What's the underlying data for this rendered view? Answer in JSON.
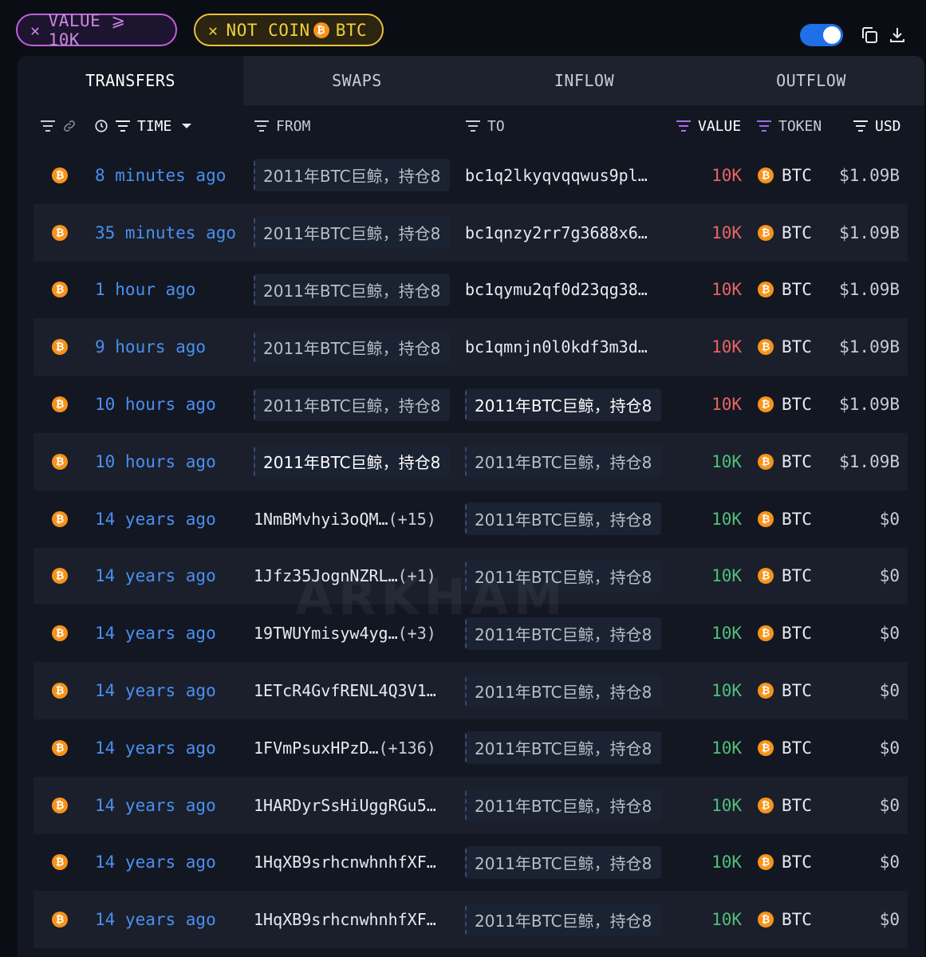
{
  "filters": [
    {
      "label": "VALUE ⩾ 10K",
      "color": "#c25fdc"
    },
    {
      "label_prefix": "NOT COIN",
      "coin_symbol": "₿",
      "label_suffix": "BTC",
      "color": "#e9c23a"
    }
  ],
  "tabs": [
    "TRANSFERS",
    "SWAPS",
    "INFLOW",
    "OUTFLOW"
  ],
  "columns": {
    "time": "TIME",
    "from": "FROM",
    "to": "TO",
    "value": "VALUE",
    "token": "TOKEN",
    "usd": "USD"
  },
  "coin_symbol": "₿",
  "watermark": "ARKHAM",
  "rows": [
    {
      "time": "8 minutes ago",
      "from": {
        "kind": "entity",
        "text": "2011年BTC巨鲸，持仓8",
        "hl": false
      },
      "to": {
        "kind": "addr",
        "text": "bc1q2lkyqvqqwus9pl…",
        "extra": ""
      },
      "value": "10K",
      "dir": "out",
      "token": "BTC",
      "usd": "$1.09B"
    },
    {
      "time": "35 minutes ago",
      "from": {
        "kind": "entity",
        "text": "2011年BTC巨鲸，持仓8",
        "hl": false
      },
      "to": {
        "kind": "addr",
        "text": "bc1qnzy2rr7g3688x6…",
        "extra": ""
      },
      "value": "10K",
      "dir": "out",
      "token": "BTC",
      "usd": "$1.09B"
    },
    {
      "time": "1 hour ago",
      "from": {
        "kind": "entity",
        "text": "2011年BTC巨鲸，持仓8",
        "hl": false
      },
      "to": {
        "kind": "addr",
        "text": "bc1qymu2qf0d23qg38…",
        "extra": ""
      },
      "value": "10K",
      "dir": "out",
      "token": "BTC",
      "usd": "$1.09B"
    },
    {
      "time": "9 hours ago",
      "from": {
        "kind": "entity",
        "text": "2011年BTC巨鲸，持仓8",
        "hl": false
      },
      "to": {
        "kind": "addr",
        "text": "bc1qmnjn0l0kdf3m3d…",
        "extra": ""
      },
      "value": "10K",
      "dir": "out",
      "token": "BTC",
      "usd": "$1.09B"
    },
    {
      "time": "10 hours ago",
      "from": {
        "kind": "entity",
        "text": "2011年BTC巨鲸，持仓8",
        "hl": false
      },
      "to": {
        "kind": "entity",
        "text": "2011年BTC巨鲸，持仓8",
        "hl": true
      },
      "value": "10K",
      "dir": "out",
      "token": "BTC",
      "usd": "$1.09B"
    },
    {
      "time": "10 hours ago",
      "from": {
        "kind": "entity",
        "text": "2011年BTC巨鲸，持仓8",
        "hl": true
      },
      "to": {
        "kind": "entity",
        "text": "2011年BTC巨鲸，持仓8",
        "hl": false
      },
      "value": "10K",
      "dir": "in",
      "token": "BTC",
      "usd": "$1.09B"
    },
    {
      "time": "14 years ago",
      "from": {
        "kind": "addr",
        "text": "1NmBMvhyi3oQM…",
        "extra": "(+15)"
      },
      "to": {
        "kind": "entity",
        "text": "2011年BTC巨鲸，持仓8",
        "hl": false
      },
      "value": "10K",
      "dir": "in",
      "token": "BTC",
      "usd": "$0"
    },
    {
      "time": "14 years ago",
      "from": {
        "kind": "addr",
        "text": "1Jfz35JognNZRL…",
        "extra": "(+1)"
      },
      "to": {
        "kind": "entity",
        "text": "2011年BTC巨鲸，持仓8",
        "hl": false
      },
      "value": "10K",
      "dir": "in",
      "token": "BTC",
      "usd": "$0"
    },
    {
      "time": "14 years ago",
      "from": {
        "kind": "addr",
        "text": "19TWUYmisyw4yg…",
        "extra": "(+3)"
      },
      "to": {
        "kind": "entity",
        "text": "2011年BTC巨鲸，持仓8",
        "hl": false
      },
      "value": "10K",
      "dir": "in",
      "token": "BTC",
      "usd": "$0"
    },
    {
      "time": "14 years ago",
      "from": {
        "kind": "addr",
        "text": "1ETcR4GvfRENL4Q3V1…",
        "extra": ""
      },
      "to": {
        "kind": "entity",
        "text": "2011年BTC巨鲸，持仓8",
        "hl": false
      },
      "value": "10K",
      "dir": "in",
      "token": "BTC",
      "usd": "$0"
    },
    {
      "time": "14 years ago",
      "from": {
        "kind": "addr",
        "text": "1FVmPsuxHPzD…",
        "extra": "(+136)"
      },
      "to": {
        "kind": "entity",
        "text": "2011年BTC巨鲸，持仓8",
        "hl": false
      },
      "value": "10K",
      "dir": "in",
      "token": "BTC",
      "usd": "$0"
    },
    {
      "time": "14 years ago",
      "from": {
        "kind": "addr",
        "text": "1HARDyrSsHiUggRGu5…",
        "extra": ""
      },
      "to": {
        "kind": "entity",
        "text": "2011年BTC巨鲸，持仓8",
        "hl": false
      },
      "value": "10K",
      "dir": "in",
      "token": "BTC",
      "usd": "$0"
    },
    {
      "time": "14 years ago",
      "from": {
        "kind": "addr",
        "text": "1HqXB9srhcnwhnhfXF…",
        "extra": ""
      },
      "to": {
        "kind": "entity",
        "text": "2011年BTC巨鲸，持仓8",
        "hl": false
      },
      "value": "10K",
      "dir": "in",
      "token": "BTC",
      "usd": "$0"
    },
    {
      "time": "14 years ago",
      "from": {
        "kind": "addr",
        "text": "1HqXB9srhcnwhnhfXF…",
        "extra": ""
      },
      "to": {
        "kind": "entity",
        "text": "2011年BTC巨鲸，持仓8",
        "hl": false
      },
      "value": "10K",
      "dir": "in",
      "token": "BTC",
      "usd": "$0"
    }
  ]
}
